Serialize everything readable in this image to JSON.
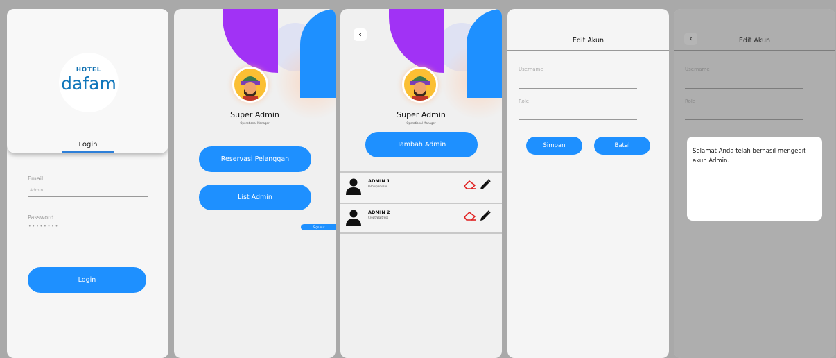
{
  "screen_login": {
    "logo_hotel": "HOTEL",
    "logo_brand": "dafam",
    "tab_label": "Login",
    "email_label": "Email",
    "email_value": "Admin",
    "password_label": "Password",
    "password_value": "••••••••",
    "login_button": "Login"
  },
  "screen_menu": {
    "name": "Super Admin",
    "subtitle": "Operational Manager",
    "reservasi_button": "Reservasi Pelanggan",
    "list_admin_button": "List Admin",
    "signout_button": "Sign out"
  },
  "screen_list": {
    "back_icon": "‹",
    "name": "Super Admin",
    "subtitle": "Operational Manager",
    "add_button": "Tambah Admin",
    "admins": [
      {
        "name": "ADMIN 1",
        "role": "FB Supervisor"
      },
      {
        "name": "ADMIN 2",
        "role": "Crept Waitress"
      }
    ]
  },
  "screen_edit": {
    "title": "Edit Akun",
    "username_label": "Username",
    "role_label": "Role",
    "save_button": "Simpan",
    "cancel_button": "Batal"
  },
  "screen_success": {
    "back_icon": "‹",
    "title": "Edit Akun",
    "username_label": "Username",
    "role_label": "Role",
    "message": "Selamat Anda telah berhasil mengedit akun Admin."
  },
  "colors": {
    "accent": "#1e90ff",
    "purple": "#a132f5",
    "delete": "#e02020"
  },
  "icons": [
    "back-icon",
    "person-icon",
    "eraser-icon",
    "pencil-icon",
    "avatar-icon"
  ]
}
